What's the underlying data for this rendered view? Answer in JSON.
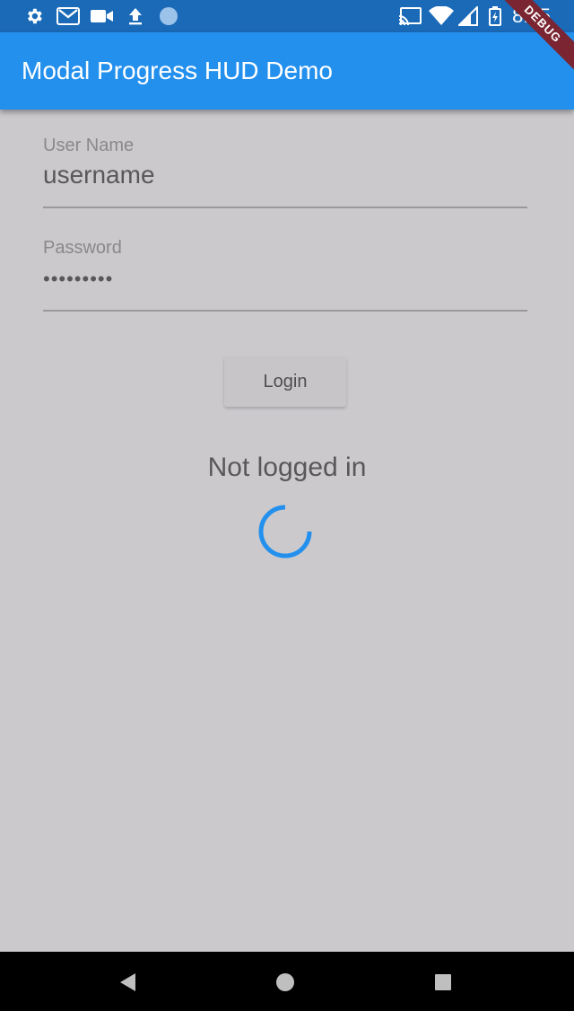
{
  "status_bar": {
    "time": "8:45",
    "icons": [
      "settings-icon",
      "gmail-icon",
      "video-camera-icon",
      "upload-icon",
      "circle-icon",
      "cast-icon",
      "wifi-icon",
      "signal-icon",
      "battery-charging-icon"
    ]
  },
  "app_bar": {
    "title": "Modal Progress HUD Demo",
    "debug_banner": "DEBUG",
    "color": "#2390ee"
  },
  "form": {
    "username": {
      "label": "User Name",
      "value": "username"
    },
    "password": {
      "label": "Password",
      "value": "•••••••••"
    },
    "login_button": "Login"
  },
  "status": {
    "text": "Not logged in",
    "loading": true,
    "spinner_color": "#2390ee"
  },
  "nav_bar": {
    "buttons": [
      "back-icon",
      "home-icon",
      "recents-icon"
    ]
  }
}
